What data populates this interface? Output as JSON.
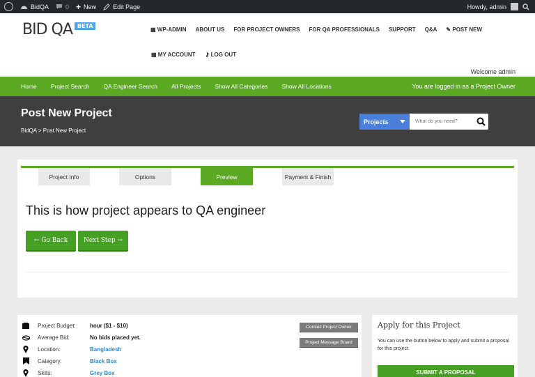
{
  "adminbar": {
    "site_name": "BidQA",
    "comments_count": "0",
    "new_label": "New",
    "edit_label": "Edit Page",
    "howdy": "Howdy, admin"
  },
  "header": {
    "logo_text": "BID QA",
    "beta": "BETA",
    "nav": [
      "WP-ADMIN",
      "ABOUT US",
      "FOR PROJECT OWNERS",
      "FOR QA PROFESSIONALS",
      "SUPPORT",
      "Q&A",
      "POST NEW"
    ],
    "my_account": "MY ACCOUNT",
    "logout": "LOG OUT",
    "welcome": "Welcome admin"
  },
  "greenbar": {
    "items": [
      "Home",
      "Project Search",
      "QA Engineer Search",
      "All Projects",
      "Show All Categories",
      "Show All Locations"
    ],
    "status": "You are logged in as a Project Owner"
  },
  "banner": {
    "title": "Post New Project",
    "breadcrumb": "BidQA > Post New Project",
    "search_select": "Projects",
    "search_placeholder": "What do you need?"
  },
  "steps": {
    "tabs": [
      "Project Info",
      "Options",
      "Preview",
      "Payment & Finish"
    ],
    "active": "Preview",
    "heading": "This is how project appears to QA engineer",
    "back": "← Go Back",
    "next": "Next Step →"
  },
  "details": {
    "rows": [
      {
        "label": "Project Budget:",
        "value": "hour ($1 - $10)",
        "icon": "budget-icon"
      },
      {
        "label": "Average Bid:",
        "value": "No bids placed yet.",
        "icon": "bid-icon"
      },
      {
        "label": "Location:",
        "value": "Bangladesh",
        "icon": "location-pin-icon"
      },
      {
        "label": "Category:",
        "value": "Black Box",
        "icon": "category-icon"
      },
      {
        "label": "Skills:",
        "value": "Grey Box",
        "icon": "skills-icon"
      }
    ],
    "contact_owner": "Contact Project Owner",
    "message_board": "Project Message Board"
  },
  "apply": {
    "title": "Apply for this Project",
    "text": "You can use the button below to apply and submit a proposal for this project.",
    "button": "SUBMIT A PROPOSAL"
  }
}
